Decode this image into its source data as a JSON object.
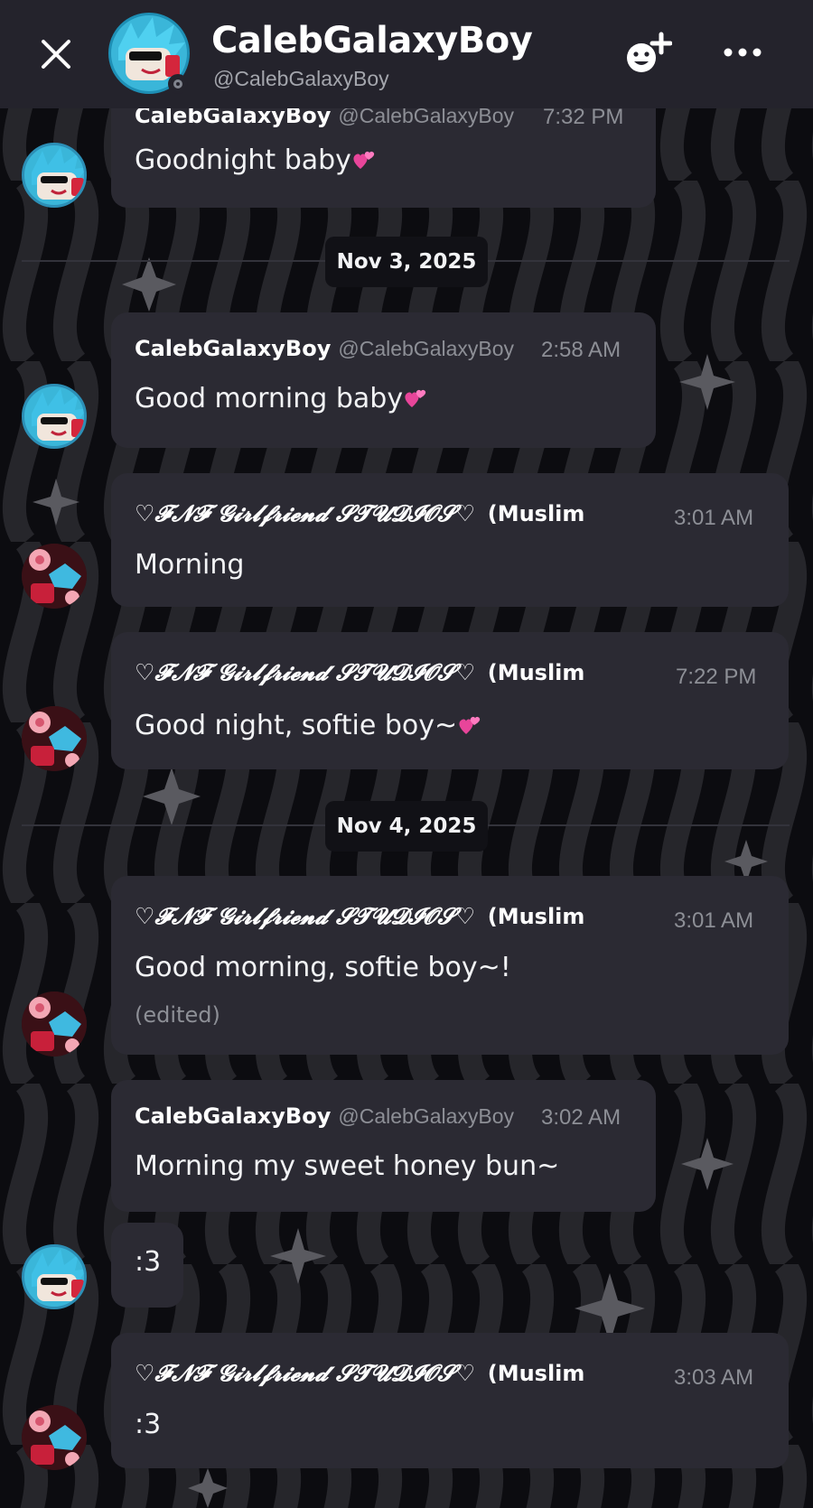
{
  "header": {
    "title": "CalebGalaxyBoy",
    "subtitle": "@CalebGalaxyBoy"
  },
  "dates": [
    "Nov 3, 2025",
    "Nov 4, 2025"
  ],
  "messages": [
    {
      "author": "CalebGalaxyBoy",
      "handle": "@CalebGalaxyBoy",
      "time": "7:32 PM",
      "text": "Goodnight baby"
    },
    {
      "author": "CalebGalaxyBoy",
      "handle": "@CalebGalaxyBoy",
      "time": "2:58 AM",
      "text": "Good morning baby"
    },
    {
      "author": "♡𝓕𝓝𝓕 𝓖𝓲𝓻𝓵𝓯𝓻𝓲𝓮𝓷𝓭 𝓢𝓣𝓤𝓓𝓘𝓞𝓢♡",
      "tag": "(Muslim",
      "time": "3:01 AM",
      "text": "Morning"
    },
    {
      "author": "♡𝓕𝓝𝓕 𝓖𝓲𝓻𝓵𝓯𝓻𝓲𝓮𝓷𝓭 𝓢𝓣𝓤𝓓𝓘𝓞𝓢♡",
      "tag": "(Muslim",
      "time": "7:22 PM",
      "text": "Good night, softie boy~"
    },
    {
      "author": "♡𝓕𝓝𝓕 𝓖𝓲𝓻𝓵𝓯𝓻𝓲𝓮𝓷𝓭 𝓢𝓣𝓤𝓓𝓘𝓞𝓢♡",
      "tag": "(Muslim",
      "time": "3:01 AM",
      "text": "Good morning, softie boy~!",
      "edited": "(edited)"
    },
    {
      "author": "CalebGalaxyBoy",
      "handle": "@CalebGalaxyBoy",
      "time": "3:02 AM",
      "text": "Morning my sweet honey bun~"
    },
    {
      "text": ":3"
    },
    {
      "author": "♡𝓕𝓝𝓕 𝓖𝓲𝓻𝓵𝓯𝓻𝓲𝓮𝓷𝓭 𝓢𝓣𝓤𝓓𝓘𝓞𝓢♡",
      "tag": "(Muslim",
      "time": "3:03 AM",
      "text": ":3"
    }
  ]
}
